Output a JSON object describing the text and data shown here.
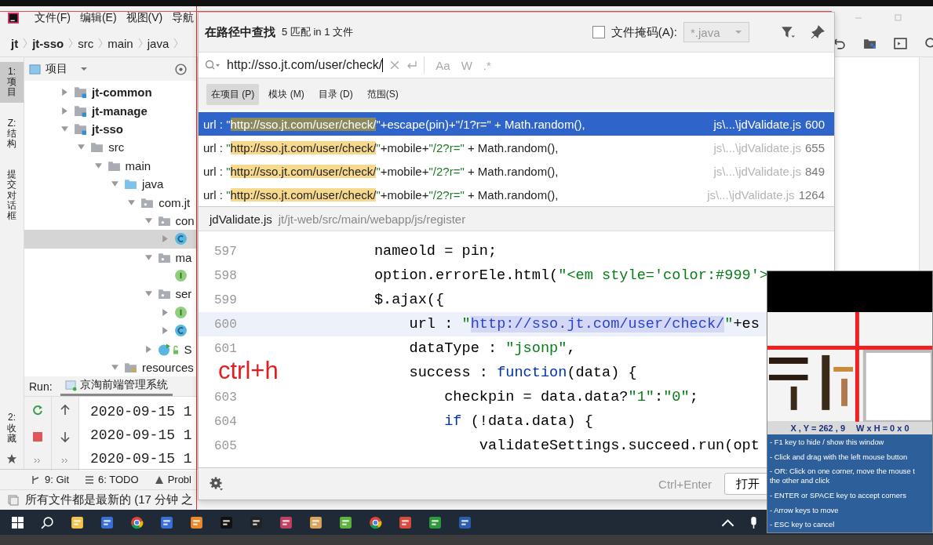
{
  "menu": {
    "items": [
      "文件(F)",
      "编辑(E)",
      "视图(V)",
      "导航"
    ]
  },
  "breadcrumb": [
    {
      "label": "jt",
      "bold": true
    },
    {
      "label": "jt-sso",
      "bold": true
    },
    {
      "label": "src",
      "bold": false
    },
    {
      "label": "main",
      "bold": false
    },
    {
      "label": "java",
      "bold": false
    }
  ],
  "tool_stripe_top": [
    {
      "label": "1: 项目",
      "selected": true
    },
    {
      "label": "Z: 结构",
      "selected": false
    },
    {
      "label": "提交对话框",
      "selected": false
    }
  ],
  "tool_stripe_bottom": [
    {
      "label": "2: 收藏",
      "selected": false
    }
  ],
  "project_panel": {
    "title": "项目",
    "tree": [
      {
        "label": "jt-common",
        "kind": "module",
        "bold": true,
        "expanded": false,
        "selected": false
      },
      {
        "label": "jt-manage",
        "kind": "module",
        "bold": true,
        "expanded": false,
        "selected": false
      },
      {
        "label": "jt-sso",
        "kind": "module",
        "bold": true,
        "expanded": true,
        "selected": false,
        "children": [
          {
            "label": "src",
            "kind": "folder",
            "bold": false,
            "expanded": true,
            "selected": false,
            "children": [
              {
                "label": "main",
                "kind": "folder",
                "bold": false,
                "expanded": true,
                "selected": false,
                "children": [
                  {
                    "label": "java",
                    "kind": "source",
                    "bold": false,
                    "expanded": true,
                    "selected": false,
                    "children": [
                      {
                        "label": "com.jt",
                        "kind": "package",
                        "bold": false,
                        "expanded": true,
                        "selected": false,
                        "children": [
                          {
                            "label": "con",
                            "kind": "package",
                            "bold": false,
                            "expanded": true,
                            "selected": false,
                            "children": [
                              {
                                "kind": "class",
                                "expanded": false,
                                "selected": true
                              }
                            ]
                          },
                          {
                            "label": "ma",
                            "kind": "package",
                            "bold": false,
                            "expanded": true,
                            "selected": false,
                            "children": [
                              {
                                "kind": "interface",
                                "selected": false
                              }
                            ]
                          },
                          {
                            "label": "ser",
                            "kind": "package",
                            "bold": false,
                            "expanded": true,
                            "selected": false,
                            "children": [
                              {
                                "kind": "interface",
                                "expanded": false,
                                "selected": false
                              },
                              {
                                "kind": "class",
                                "expanded": false,
                                "selected": false
                              }
                            ]
                          },
                          {
                            "label": "S",
                            "kind": "app",
                            "bold": false,
                            "expanded": false,
                            "selected": false
                          }
                        ]
                      }
                    ]
                  },
                  {
                    "label": "resources",
                    "kind": "resources",
                    "bold": false,
                    "expanded": true,
                    "selected": false
                  }
                ]
              }
            ]
          }
        ]
      }
    ]
  },
  "run_panel": {
    "label": "Run:",
    "tab": "京淘前端管理系统",
    "log_lines": [
      "2020-09-15 1",
      "2020-09-15 1",
      "2020-09-15 1"
    ]
  },
  "tool_tabs": [
    "9: Git",
    "6: TODO",
    "Probl"
  ],
  "status_bar": {
    "message": "所有文件都是最新的 (17 分钟 之"
  },
  "find_dialog": {
    "title": "在路径中查找",
    "summary": "5 匹配 in 1 文件",
    "file_mask": {
      "label": "文件掩码(A):",
      "checked": false,
      "value": "*.java"
    },
    "search": {
      "value": "http://sso.jt.com/user/check/"
    },
    "options": [
      "Aa",
      "W",
      ".*"
    ],
    "scopes": [
      {
        "label": "在项目 (P)",
        "selected": true
      },
      {
        "label": "模块 (M)",
        "selected": false
      },
      {
        "label": "目录 (D)",
        "selected": false
      },
      {
        "label": "范围(S)",
        "selected": false
      }
    ],
    "results": [
      {
        "selected": true,
        "segments": [
          {
            "kind": "text",
            "text": "url : "
          },
          {
            "kind": "string",
            "text": "\""
          },
          {
            "kind": "match",
            "text": "http://sso.jt.com/user/check/"
          },
          {
            "kind": "string",
            "text": "\""
          },
          {
            "kind": "text",
            "text": "+escape(pin)+"
          },
          {
            "kind": "string",
            "text": "\"/1?r=\""
          },
          {
            "kind": "text",
            "text": " + Math.random(),"
          }
        ],
        "file": "js\\...\\jdValidate.js",
        "line": "600"
      },
      {
        "selected": false,
        "segments": [
          {
            "kind": "text",
            "text": "url : "
          },
          {
            "kind": "string",
            "text": "\""
          },
          {
            "kind": "match",
            "text": "http://sso.jt.com/user/check/"
          },
          {
            "kind": "string",
            "text": "\""
          },
          {
            "kind": "text",
            "text": "+mobile+"
          },
          {
            "kind": "string",
            "text": "\"/2?r=\""
          },
          {
            "kind": "text",
            "text": " + Math.random(),"
          }
        ],
        "file": "js\\...\\jdValidate.js",
        "line": "655"
      },
      {
        "selected": false,
        "segments": [
          {
            "kind": "text",
            "text": "url : "
          },
          {
            "kind": "string",
            "text": "\""
          },
          {
            "kind": "match",
            "text": "http://sso.jt.com/user/check/"
          },
          {
            "kind": "string",
            "text": "\""
          },
          {
            "kind": "text",
            "text": "+mobile+"
          },
          {
            "kind": "string",
            "text": "\"/2?r=\""
          },
          {
            "kind": "text",
            "text": " + Math.random(),"
          }
        ],
        "file": "js\\...\\jdValidate.js",
        "line": "849"
      },
      {
        "selected": false,
        "segments": [
          {
            "kind": "text",
            "text": "url : "
          },
          {
            "kind": "string",
            "text": "\""
          },
          {
            "kind": "match",
            "text": "http://sso.jt.com/user/check/"
          },
          {
            "kind": "string",
            "text": "\""
          },
          {
            "kind": "text",
            "text": "+mobile+"
          },
          {
            "kind": "string",
            "text": "\"/2?r=\""
          },
          {
            "kind": "text",
            "text": " + Math.random(),"
          }
        ],
        "file": "js\\...\\jdValidate.js",
        "line": "1264"
      }
    ],
    "preview": {
      "file": "jdValidate.js",
      "path": "jt/jt-web/src/main/webapp/js/register",
      "lines": [
        {
          "number": "597",
          "current": false,
          "tokens": [
            {
              "kind": "plain",
              "text": "            nameold = pin;"
            }
          ]
        },
        {
          "number": "598",
          "current": false,
          "tokens": [
            {
              "kind": "plain",
              "text": "            option.errorEle.html("
            },
            {
              "kind": "string",
              "text": "\"<em style='color:#999'>"
            }
          ]
        },
        {
          "number": "599",
          "current": false,
          "tokens": [
            {
              "kind": "plain",
              "text": "            $.ajax({"
            }
          ]
        },
        {
          "number": "600",
          "current": true,
          "tokens": [
            {
              "kind": "plain",
              "text": "                url : "
            },
            {
              "kind": "string",
              "text": "\""
            },
            {
              "kind": "url",
              "text": "http://sso.jt.com/user/check/"
            },
            {
              "kind": "string",
              "text": "\""
            },
            {
              "kind": "plain",
              "text": "+es"
            }
          ]
        },
        {
          "number": "601",
          "current": false,
          "tokens": [
            {
              "kind": "plain",
              "text": "                dataType : "
            },
            {
              "kind": "string",
              "text": "\"jsonp\""
            },
            {
              "kind": "plain",
              "text": ","
            }
          ]
        },
        {
          "current": false,
          "tokens": [
            {
              "kind": "plain",
              "text": "                success : "
            },
            {
              "kind": "keyword",
              "text": "function"
            },
            {
              "kind": "plain",
              "text": "(data) {"
            }
          ]
        },
        {
          "number": "603",
          "current": false,
          "tokens": [
            {
              "kind": "plain",
              "text": "                    checkpin = data.data?"
            },
            {
              "kind": "string",
              "text": "\"1\""
            },
            {
              "kind": "plain",
              "text": ":"
            },
            {
              "kind": "string",
              "text": "\"0\""
            },
            {
              "kind": "plain",
              "text": ";"
            }
          ]
        },
        {
          "number": "604",
          "current": false,
          "tokens": [
            {
              "kind": "keyword",
              "text": "                    if"
            },
            {
              "kind": "plain",
              "text": " (!data.data) {"
            }
          ]
        },
        {
          "number": "605",
          "current": false,
          "tokens": [
            {
              "kind": "plain",
              "text": "                        validateSettings.succeed.run(opt"
            }
          ]
        }
      ]
    },
    "shortcut": "Ctrl+Enter",
    "open_button": "打开"
  },
  "annotation": "ctrl+h",
  "capture_tool": {
    "readout": [
      "X , Y = 262 , 9",
      "W x H = 0 x 0"
    ],
    "hints": [
      "- F1 key to hide / show this window",
      "- Click and drag with the left mouse button",
      "- OR: Click on one corner, move the mouse t\nthe other and click",
      "- ENTER or SPACE key to accept corners",
      "- Arrow keys to move",
      "- ESC key to cancel"
    ]
  }
}
